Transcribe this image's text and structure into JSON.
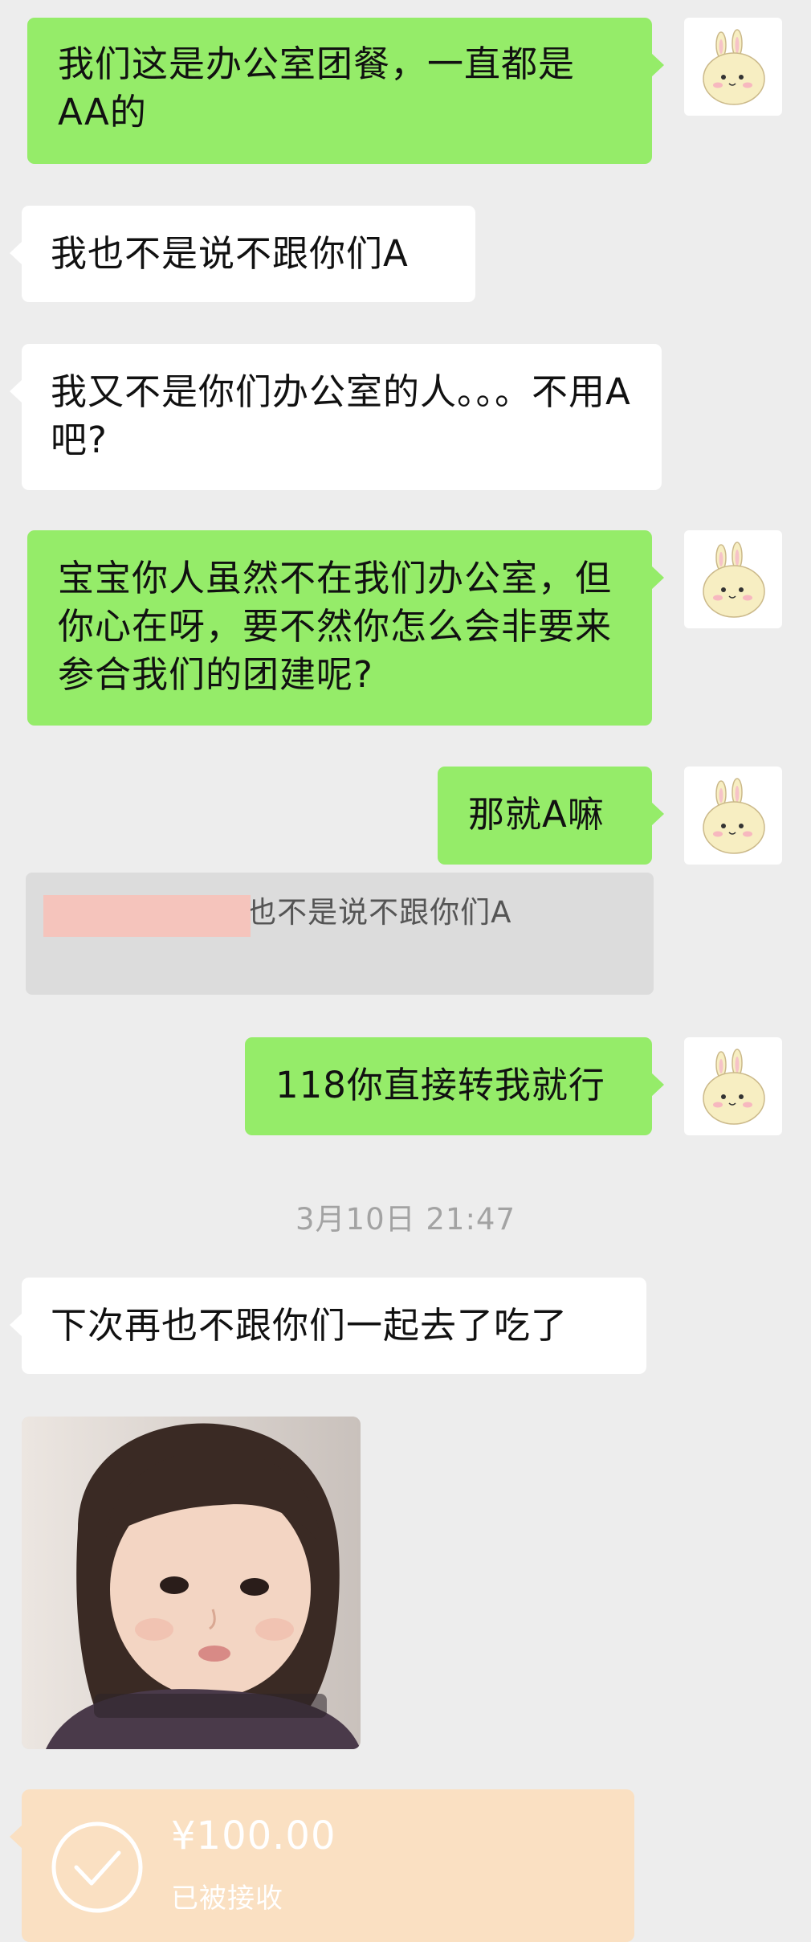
{
  "messages": [
    {
      "text": "我们这是办公室团餐，一直都是AA的"
    },
    {
      "text": "我也不是说不跟你们A"
    },
    {
      "text": "我又不是你们办公室的人。。。不用A吧?"
    },
    {
      "text": "宝宝你人虽然不在我们办公室，但你心在呀，要不然你怎么会非要来参合我们的团建呢?"
    },
    {
      "text": "那就A嘛"
    },
    {
      "text": "118你直接转我就行"
    },
    {
      "text": "下次再也不跟你们一起去了吃了"
    }
  ],
  "quote": {
    "text": "欠我18元：我也不是说不跟你们A",
    "redacted": true
  },
  "timestamp": "3月10日 21:47",
  "photo": {
    "kind": "sticker-photo-of-child"
  },
  "transfer": {
    "amount": "¥100.00",
    "status": "已被接收",
    "icon": "check-circle-icon"
  },
  "avatar": {
    "icon": "bunny-avatar-icon"
  },
  "colors": {
    "background": "#ededed",
    "outgoing_bubble": "#95ec69",
    "incoming_bubble": "#ffffff",
    "quote_bg": "#dcdcdc",
    "transfer_bg": "#fae0c2",
    "timestamp_text": "#a3a3a3"
  }
}
